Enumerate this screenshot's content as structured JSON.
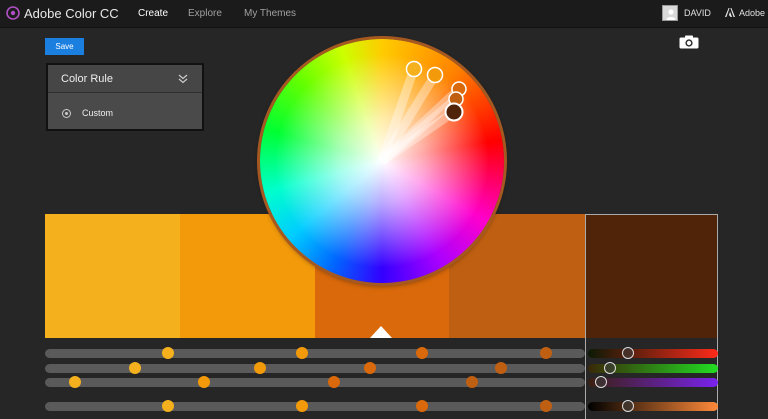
{
  "app": {
    "title": "Adobe Color CC"
  },
  "nav": [
    {
      "label": "Create",
      "active": true
    },
    {
      "label": "Explore",
      "active": false
    },
    {
      "label": "My Themes",
      "active": false
    }
  ],
  "user": {
    "name": "DAVID",
    "brand": "Adobe"
  },
  "toolbar": {
    "save_label": "Save",
    "camera_icon": "camera-icon"
  },
  "color_rule": {
    "title": "Color Rule",
    "selected_option": "Custom"
  },
  "swatches": [
    {
      "color": "#f5b01e"
    },
    {
      "color": "#f39a0b"
    },
    {
      "color": "#d9690a"
    },
    {
      "color": "#bf5f12"
    },
    {
      "color": "#4f2408",
      "selected": true
    }
  ],
  "wheel": {
    "markers": [
      {
        "color": "#f5b01e"
      },
      {
        "color": "#f39a0b"
      },
      {
        "color": "#d9690a"
      },
      {
        "color": "#bf5f12"
      },
      {
        "color": "#4f2408",
        "selected": true
      }
    ]
  },
  "colors": {
    "accent": "#1b7fe0",
    "background": "#262626",
    "topbar": "#1b1b1b"
  }
}
